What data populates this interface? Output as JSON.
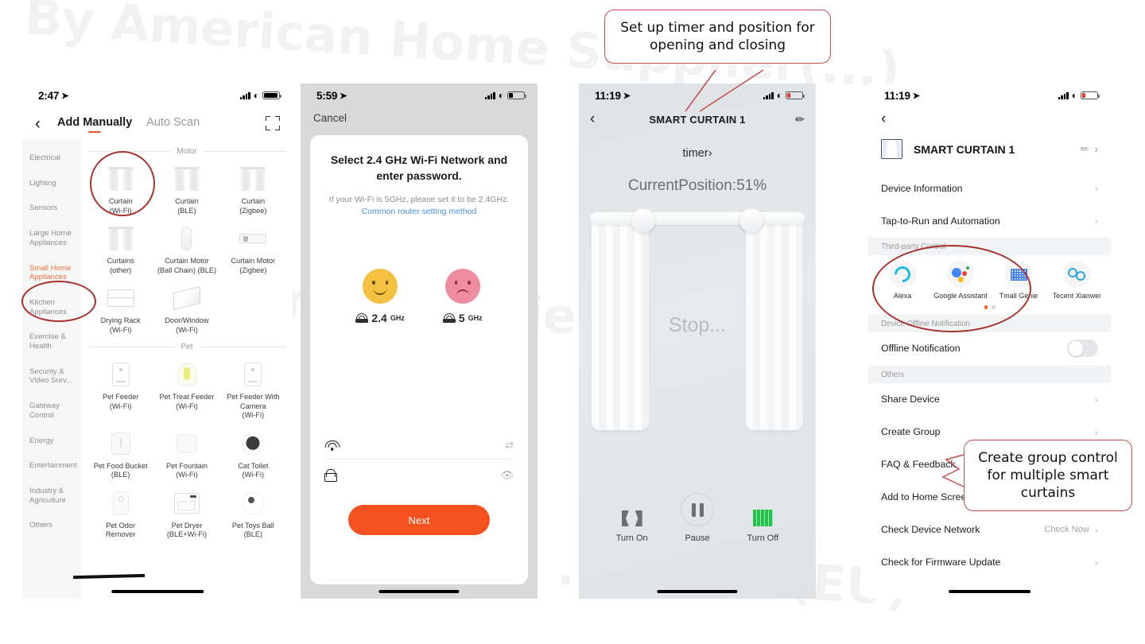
{
  "watermark": {
    "line1": "By American Home Supplier(...)",
    "line2": "n Home Supplier(...)",
    "line3": "...Home (EU)"
  },
  "annotations": [
    {
      "id": "timer-callout",
      "text": "Set up timer and position for opening and closing"
    },
    {
      "id": "group-callout",
      "text": "Create group control for multiple smart curtains"
    }
  ],
  "phone1": {
    "status": {
      "time": "2:47",
      "location_icon": "location-arrow-icon",
      "battery_level": 85
    },
    "nav": {
      "back_icon": "chevron-left-icon",
      "tab_active": "Add Manually",
      "tab_inactive": "Auto Scan",
      "scan_icon": "scan-frame-icon"
    },
    "categories": [
      {
        "label": "Electrical",
        "selected": false
      },
      {
        "label": "Lighting",
        "selected": false
      },
      {
        "label": "Sensors",
        "selected": false
      },
      {
        "label": "Large Home Appliances",
        "selected": false
      },
      {
        "label": "Small Home Appliances",
        "selected": true
      },
      {
        "label": "Kitchen Appliances",
        "selected": false
      },
      {
        "label": "Exercise & Health",
        "selected": false
      },
      {
        "label": "Security & Video Surv...",
        "selected": false
      },
      {
        "label": "Gateway Control",
        "selected": false
      },
      {
        "label": "Energy",
        "selected": false
      },
      {
        "label": "Entertainment",
        "selected": false
      },
      {
        "label": "Industry & Agriculture",
        "selected": false
      },
      {
        "label": "Others",
        "selected": false
      }
    ],
    "sections": [
      {
        "title": "Motor",
        "items": [
          {
            "name": "Curtain",
            "proto": "(Wi-Fi)",
            "icon": "curtain-icon"
          },
          {
            "name": "Curtain",
            "proto": "(BLE)",
            "icon": "curtain-icon"
          },
          {
            "name": "Curtain",
            "proto": "(Zigbee)",
            "icon": "curtain-icon"
          },
          {
            "name": "Curtains",
            "proto": "(other)",
            "icon": "curtain-icon"
          },
          {
            "name": "Curtain Motor",
            "proto": "(Ball Chain) (BLE)",
            "icon": "curtain-motor-icon"
          },
          {
            "name": "Curtain Motor",
            "proto": "(Zigbee)",
            "icon": "curtain-rail-icon"
          },
          {
            "name": "Drying Rack",
            "proto": "(Wi-Fi)",
            "icon": "drying-rack-icon"
          },
          {
            "name": "Door/Window",
            "proto": "(Wi-Fi)",
            "icon": "door-window-icon"
          }
        ]
      },
      {
        "title": "Pet",
        "items": [
          {
            "name": "Pet Feeder",
            "proto": "(Wi-Fi)",
            "icon": "pet-feeder-icon"
          },
          {
            "name": "Pet Treat Feeder",
            "proto": "(Wi-Fi)",
            "icon": "pet-treat-feeder-icon"
          },
          {
            "name": "Pet Feeder With Camera",
            "proto": "(Wi-Fi)",
            "icon": "pet-feeder-camera-icon"
          },
          {
            "name": "Pet Food Bucket",
            "proto": "(BLE)",
            "icon": "pet-food-bucket-icon"
          },
          {
            "name": "Pet Fountain",
            "proto": "(Wi-Fi)",
            "icon": "pet-fountain-icon"
          },
          {
            "name": "Cat Toilet",
            "proto": "(Wi-Fi)",
            "icon": "cat-toilet-icon"
          },
          {
            "name": "Pet Odor",
            "proto": "Remover",
            "icon": "pet-odor-icon"
          },
          {
            "name": "Pet Dryer",
            "proto": "(BLE+Wi-Fi)",
            "icon": "pet-dryer-icon"
          },
          {
            "name": "Pet Toys Ball",
            "proto": "(BLE)",
            "icon": "pet-toys-ball-icon"
          }
        ]
      }
    ]
  },
  "phone2": {
    "status": {
      "time": "5:59",
      "location_icon": "location-arrow-icon",
      "battery_level": 25
    },
    "cancel": "Cancel",
    "title": "Select 2.4 GHz Wi-Fi Network and enter password.",
    "subtitle": "If your Wi-Fi is 5GHz, please set it to be 2.4GHz.",
    "link": "Common router setting method",
    "bands": [
      {
        "value": "2.4",
        "unit": "GHz",
        "face": "happy-face-icon",
        "color": "#f5c141"
      },
      {
        "value": "5",
        "unit": "GHz",
        "face": "sad-face-icon",
        "color": "#f08ca0"
      }
    ],
    "ssid_field": {
      "icon": "wifi-icon",
      "value": "",
      "placeholder": "",
      "trailing_icon": "switch-network-icon"
    },
    "password_field": {
      "icon": "lock-icon",
      "value": "",
      "placeholder": "",
      "trailing_icon": "eye-off-icon"
    },
    "next_button": "Next"
  },
  "phone3": {
    "status": {
      "time": "11:19",
      "location_icon": "location-arrow-icon",
      "battery_level": 15
    },
    "back_icon": "chevron-left-icon",
    "title": "SMART CURTAIN 1",
    "edit_icon": "pencil-icon",
    "timer_label": "timer",
    "timer_chevron": "chevron-right-icon",
    "position_text": "CurrentPosition:51%",
    "position_percent": 51,
    "state_text": "Stop...",
    "controls": [
      {
        "label": "Turn On",
        "icon": "curtain-open-icon"
      },
      {
        "label": "Pause",
        "icon": "pause-icon"
      },
      {
        "label": "Turn Off",
        "icon": "curtain-closed-icon"
      }
    ]
  },
  "phone4": {
    "status": {
      "time": "11:19",
      "location_icon": "location-arrow-icon",
      "battery_level": 15
    },
    "back_icon": "chevron-left-icon",
    "device": {
      "icon": "curtain-device-icon",
      "name": "SMART CURTAIN 1",
      "edit_icon": "pencil-icon",
      "chevron": "chevron-right-icon"
    },
    "rows_top": [
      {
        "label": "Device Information",
        "chevron": "chevron-right-icon"
      },
      {
        "label": "Tap-to-Run and Automation",
        "chevron": "chevron-right-icon"
      }
    ],
    "third_party": {
      "header": "Third-party Control",
      "items": [
        {
          "label": "Alexa",
          "icon": "alexa-icon"
        },
        {
          "label": "Google Assistant",
          "icon": "google-assistant-icon"
        },
        {
          "label": "Tmall Genie",
          "icon": "tmall-genie-icon"
        },
        {
          "label": "Tecent Xiaowei",
          "icon": "tencent-xiaowei-icon"
        }
      ],
      "page_dots": 2,
      "active_dot": 0
    },
    "offline": {
      "header": "Device Offline Notification",
      "label": "Offline Notification",
      "enabled": false
    },
    "others": {
      "header": "Others",
      "rows": [
        {
          "label": "Share Device",
          "hint": "",
          "chevron": "chevron-right-icon"
        },
        {
          "label": "Create Group",
          "hint": "",
          "chevron": "chevron-right-icon"
        },
        {
          "label": "FAQ & Feedback",
          "hint": "",
          "chevron": "chevron-right-icon"
        },
        {
          "label": "Add to Home Screen",
          "hint": "",
          "chevron": "chevron-right-icon"
        },
        {
          "label": "Check Device Network",
          "hint": "Check Now",
          "chevron": "chevron-right-icon"
        },
        {
          "label": "Check for Firmware Update",
          "hint": "",
          "chevron": "chevron-right-icon"
        }
      ]
    }
  }
}
